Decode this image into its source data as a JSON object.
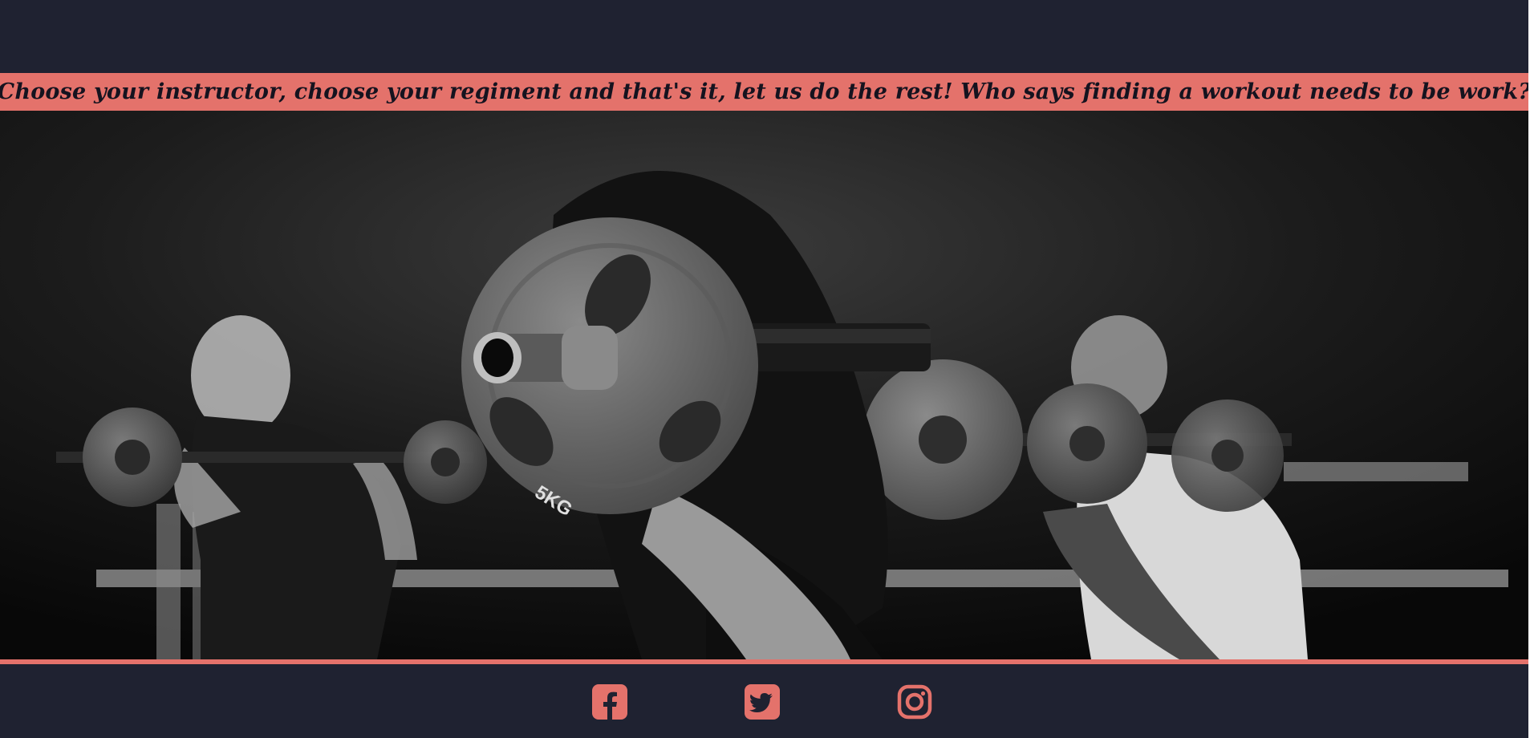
{
  "tagline": {
    "text": "Choose your instructor, choose your regiment and that's it, let us do the rest! Who says finding a workout needs to be work?"
  },
  "hero": {
    "image": "barbell-class-photo",
    "plate_label": "5KG"
  },
  "footer": {
    "social": [
      {
        "name": "facebook",
        "icon": "facebook-icon"
      },
      {
        "name": "twitter",
        "icon": "twitter-icon"
      },
      {
        "name": "instagram",
        "icon": "instagram-icon"
      }
    ]
  },
  "colors": {
    "background": "#1f2231",
    "accent": "#e4726b",
    "text_dark": "#15131f"
  }
}
